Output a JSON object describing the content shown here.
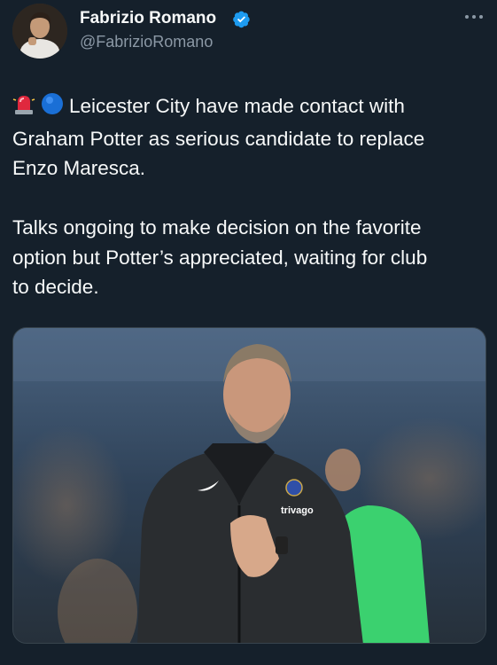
{
  "author": {
    "display_name": "Fabrizio Romano",
    "handle": "@FabrizioRomano",
    "verified": true,
    "avatar_icon": "user-photo"
  },
  "menu": {
    "icon": "more-horizontal-icon"
  },
  "tweet": {
    "emojis": [
      "police-light-emoji",
      "blue-circle-emoji"
    ],
    "para1_lines": [
      "Leicester City have made contact with",
      "Graham Potter as serious candidate to replace",
      "Enzo Maresca."
    ],
    "para2_lines": [
      "Talks ongoing to make decision on the favorite",
      "option but Potter’s appreciated, waiting for club",
      "to decide."
    ]
  },
  "media": {
    "jacket_text": "trivago",
    "colors": {
      "background": "#15202b",
      "verified": "#1d9bf0",
      "jacket": "#2a2d30",
      "keeper_kit": "#3bd16f"
    }
  }
}
